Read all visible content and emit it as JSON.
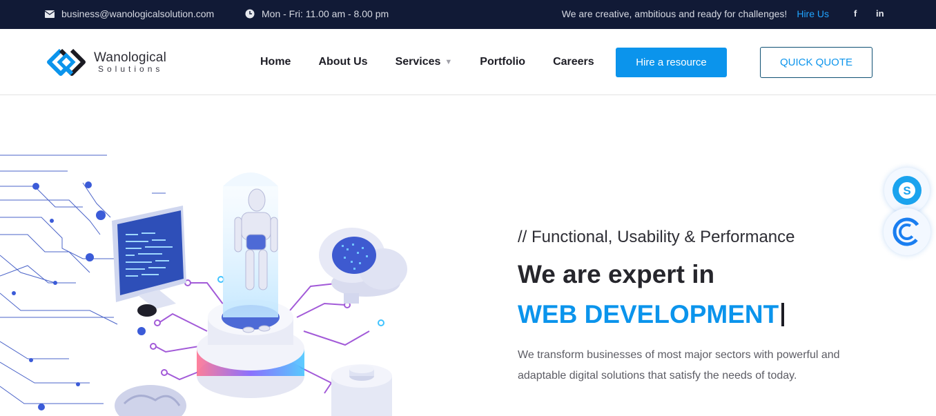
{
  "topbar": {
    "email": "business@wanologicalsolution.com",
    "hours": "Mon - Fri: 11.00 am - 8.00 pm",
    "tagline": "We are creative, ambitious and ready for challenges!",
    "hire_link": "Hire Us",
    "facebook": "f",
    "linkedin": "in"
  },
  "logo": {
    "line1": "Wanological",
    "line2": "Solutions"
  },
  "nav": {
    "items": [
      {
        "label": "Home"
      },
      {
        "label": "About Us"
      },
      {
        "label": "Services"
      },
      {
        "label": "Portfolio"
      },
      {
        "label": "Careers"
      }
    ],
    "hire_button": "Hire a resource",
    "quote_button": "QUICK QUOTE"
  },
  "hero": {
    "subtitle": "// Functional, Usability & Performance",
    "headline": "We are expert in",
    "highlight": "WEB DEVELOPMENT",
    "description": "We transform businesses of most major sectors with powerful and adaptable digital solutions that satisfy the needs of today."
  },
  "colors": {
    "topbar_bg": "#111a36",
    "accent": "#0b94ec",
    "heading": "#26262c"
  }
}
